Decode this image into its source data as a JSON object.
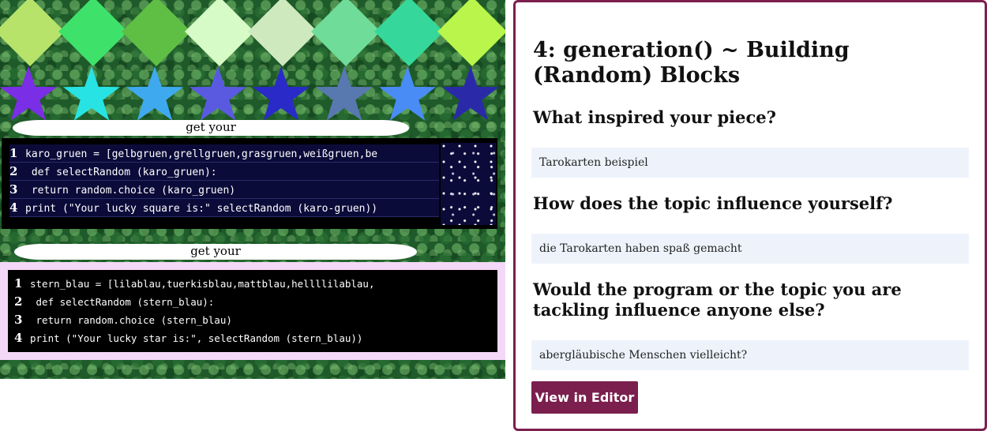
{
  "art": {
    "diamond_colors": [
      "#b7e36a",
      "#3ee26a",
      "#5fbf45",
      "#d7fbc6",
      "#cfe9bf",
      "#6fdc9a",
      "#35d89a",
      "#b9f54a"
    ],
    "star_colors": [
      "#7a2ee6",
      "#27e3e3",
      "#3fa9f0",
      "#5a5ae0",
      "#2a2ac8",
      "#5878b0",
      "#4a8cf5",
      "#2a2aa8"
    ],
    "bar1_text": "get your",
    "bar2_text": "get your",
    "code1": [
      {
        "n": "1",
        "text": "karo_gruen = [gelbgruen,grellgruen,grasgruen,weißgruen,be"
      },
      {
        "n": "2",
        "text": " def selectRandom (karo_gruen):"
      },
      {
        "n": "3",
        "text": " return random.choice (karo_gruen)"
      },
      {
        "n": "4",
        "text": "print (\"Your lucky square is:\" selectRandom (karo-gruen))"
      }
    ],
    "code2": [
      {
        "n": "1",
        "text": "stern_blau = [lilablau,tuerkisblau,mattblau,hellllilablau,"
      },
      {
        "n": "2",
        "text": " def selectRandom (stern_blau):"
      },
      {
        "n": "3",
        "text": " return random.choice (stern_blau)"
      },
      {
        "n": "4",
        "text": "print (\"Your lucky star is:\", selectRandom (stern_blau))"
      }
    ]
  },
  "card": {
    "title": "4: generation() ~ Building (Random) Blocks",
    "q1": "What inspired your piece?",
    "a1": "Tarokarten beispiel",
    "q2": "How does the topic influence yourself?",
    "a2": "die Tarokarten haben spaß gemacht",
    "q3": "Would the program or the topic you are tackling influence anyone else?",
    "a3": "abergläubische Menschen vielleicht?",
    "button": "View in Editor",
    "accent": "#7b1f4e"
  }
}
